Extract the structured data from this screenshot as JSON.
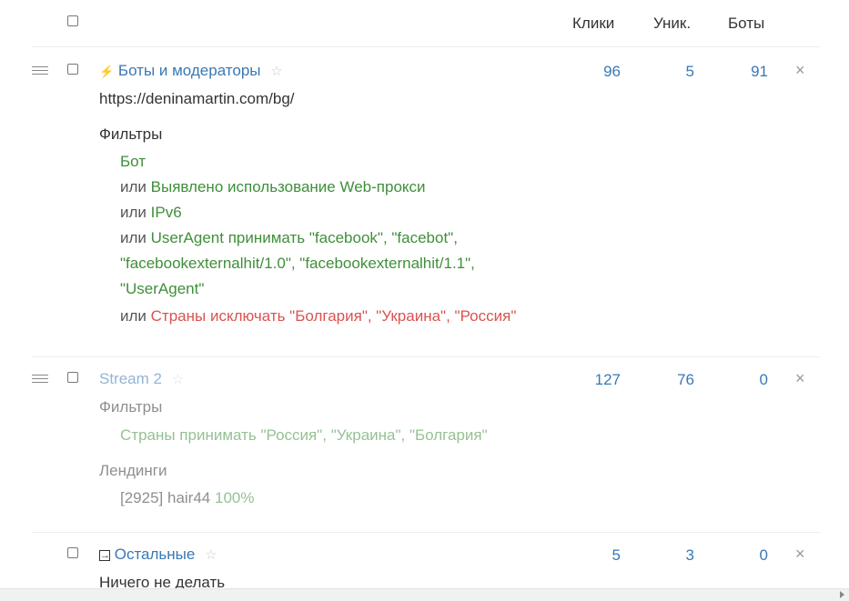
{
  "header": {
    "col_clicks": "Клики",
    "col_unique": "Уник.",
    "col_bots": "Боты"
  },
  "streams": [
    {
      "icon": "bolt-icon",
      "name": "Боты и модераторы",
      "url": "https://deninamartin.com/bg/",
      "clicks": "96",
      "unique": "5",
      "bots": "91",
      "filters_label": "Фильтры",
      "conditions": [
        {
          "prefix": "",
          "text": "Бот",
          "color": "#3f8f3a"
        },
        {
          "prefix": "или",
          "text": "Выявлено использование Web-прокси",
          "color": "#3f8f3a"
        },
        {
          "prefix": "или",
          "text": "IPv6",
          "color": "#3f8f3a"
        },
        {
          "prefix": "или",
          "text": "UserAgent принимать \"facebook\", \"facebot\",",
          "color": "#3f8f3a"
        },
        {
          "prefix": "",
          "text": "\"facebookexternalhit/1.0\", \"facebookexternalhit/1.1\",",
          "color": "#3f8f3a"
        },
        {
          "prefix": "",
          "text": "\"UserAgent\"",
          "color": "#3f8f3a"
        },
        {
          "prefix": "или",
          "text": "Страны исключать \"Болгария\", \"Украина\", \"Россия\"",
          "color": "#d9534f"
        }
      ]
    },
    {
      "name": "Stream 2",
      "clicks": "127",
      "unique": "76",
      "bots": "0",
      "filters_label": "Фильтры",
      "condition": "Страны принимать \"Россия\", \"Украина\", \"Болгария\"",
      "landings_label": "Лендинги",
      "landing_name": "[2925] hair44",
      "landing_share": "100%"
    },
    {
      "icon": "exit-arrow-icon",
      "name": "Остальные",
      "action": "Ничего не делать",
      "clicks": "5",
      "unique": "3",
      "bots": "0"
    }
  ],
  "glyphs": {
    "star": "☆",
    "close": "×",
    "bolt": "⚡",
    "exit": "⇥"
  }
}
